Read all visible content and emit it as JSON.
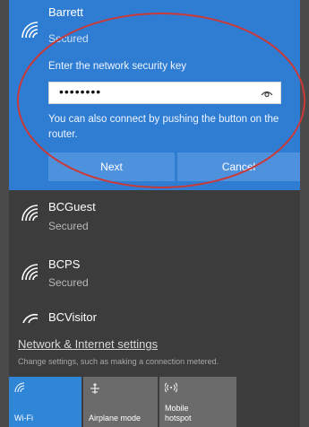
{
  "selected_network": {
    "name": "Barrett",
    "status": "Secured",
    "prompt": "Enter the network security key",
    "password_value": "••••••••",
    "hint": "You can also connect by pushing the button on the router.",
    "next_label": "Next",
    "cancel_label": "Cancel"
  },
  "networks": [
    {
      "name": "BCGuest",
      "status": "Secured"
    },
    {
      "name": "BCPS",
      "status": "Secured"
    },
    {
      "name": "BCVisitor",
      "status": ""
    }
  ],
  "settings": {
    "link": "Network & Internet settings",
    "description": "Change settings, such as making a connection metered."
  },
  "quick_actions": {
    "wifi_label": "Wi-Fi",
    "airplane_label": "Airplane mode",
    "hotspot_label_line1": "Mobile",
    "hotspot_label_line2": "hotspot"
  },
  "colors": {
    "accent": "#2f7dd3",
    "button": "#4e92de",
    "panel": "#3c3c3c",
    "annotation": "#c83a3a"
  },
  "icons": [
    "wifi-icon",
    "eye-icon",
    "airplane-icon",
    "hotspot-icon"
  ]
}
